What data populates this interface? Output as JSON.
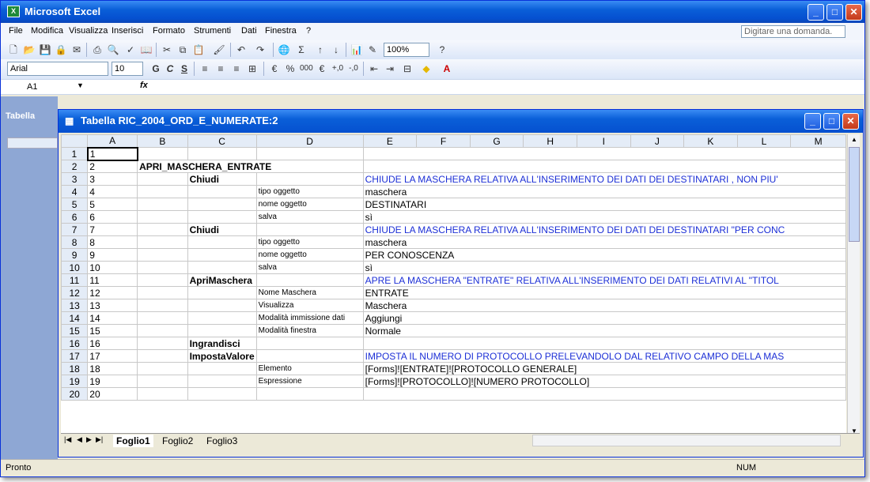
{
  "app": {
    "title": "Microsoft Excel",
    "icon": "excel-icon"
  },
  "menu": {
    "items": [
      "File",
      "Modifica",
      "Visualizza",
      "Inserisci",
      "Formato",
      "Strumenti",
      "Dati",
      "Finestra",
      "?"
    ],
    "help_placeholder": "Digitare una domanda."
  },
  "toolbar": {
    "zoom": "100%"
  },
  "format": {
    "font": "Arial",
    "size": "10"
  },
  "formula_bar": {
    "cell": "A1",
    "fx": "fx",
    "content": ""
  },
  "side_window": {
    "label": "Tabella"
  },
  "window": {
    "title": "Tabella RIC_2004_ORD_E_NUMERATE:2"
  },
  "columns": [
    "A",
    "B",
    "C",
    "D",
    "E",
    "F",
    "G",
    "H",
    "I",
    "J",
    "K",
    "L",
    "M"
  ],
  "row_numbers": [
    "1",
    "2",
    "3",
    "4",
    "5",
    "6",
    "7",
    "8",
    "9",
    "10",
    "11",
    "12",
    "13",
    "14",
    "15",
    "16",
    "17",
    "18",
    "19",
    "20"
  ],
  "rows": [
    {
      "a": "1",
      "b": "",
      "c": "",
      "d": "",
      "e": ""
    },
    {
      "a": "2",
      "b": "APRI_MASCHERA_ENTRATE",
      "c": "",
      "d": "",
      "e": ""
    },
    {
      "a": "3",
      "b": "",
      "c": "Chiudi",
      "d": "",
      "e": "CHIUDE LA MASCHERA RELATIVA ALL'INSERIMENTO DEI DATI DEI DESTINATARI , NON PIU'"
    },
    {
      "a": "4",
      "b": "",
      "c": "",
      "d": "tipo oggetto",
      "e": "maschera"
    },
    {
      "a": "5",
      "b": "",
      "c": "",
      "d": "nome oggetto",
      "e": "DESTINATARI"
    },
    {
      "a": "6",
      "b": "",
      "c": "",
      "d": "salva",
      "e": "sì"
    },
    {
      "a": "7",
      "b": "",
      "c": "Chiudi",
      "d": "",
      "e": "CHIUDE LA MASCHERA RELATIVA ALL'INSERIMENTO DEI DATI DEI DESTINATARI \"PER CONC"
    },
    {
      "a": "8",
      "b": "",
      "c": "",
      "d": "tipo oggetto",
      "e": "maschera"
    },
    {
      "a": "9",
      "b": "",
      "c": "",
      "d": "nome oggetto",
      "e": "PER CONOSCENZA"
    },
    {
      "a": "10",
      "b": "",
      "c": "",
      "d": "salva",
      "e": "sì"
    },
    {
      "a": "11",
      "b": "",
      "c": "ApriMaschera",
      "d": "",
      "e": "APRE LA MASCHERA \"ENTRATE\" RELATIVA ALL'INSERIMENTO DEI DATI RELATIVI AL \"TITOL"
    },
    {
      "a": "12",
      "b": "",
      "c": "",
      "d": "Nome Maschera",
      "e": "ENTRATE"
    },
    {
      "a": "13",
      "b": "",
      "c": "",
      "d": "Visualizza",
      "e": "Maschera"
    },
    {
      "a": "14",
      "b": "",
      "c": "",
      "d": "Modalità immissione dati",
      "e": "Aggiungi"
    },
    {
      "a": "15",
      "b": "",
      "c": "",
      "d": "Modalità finestra",
      "e": "Normale"
    },
    {
      "a": "16",
      "b": "",
      "c": "Ingrandisci",
      "d": "",
      "e": ""
    },
    {
      "a": "17",
      "b": "",
      "c": "ImpostaValore",
      "d": "",
      "e": "IMPOSTA IL NUMERO DI PROTOCOLLO PRELEVANDOLO DAL RELATIVO CAMPO DELLA MAS"
    },
    {
      "a": "18",
      "b": "",
      "c": "",
      "d": "Elemento",
      "e": "[Forms]![ENTRATE]![PROTOCOLLO GENERALE]"
    },
    {
      "a": "19",
      "b": "",
      "c": "",
      "d": "Espressione",
      "e": "[Forms]![PROTOCOLLO]![NUMERO PROTOCOLLO]"
    },
    {
      "a": "20",
      "b": "",
      "c": "",
      "d": "",
      "e": ""
    }
  ],
  "sheets": [
    "Foglio1",
    "Foglio2",
    "Foglio3"
  ],
  "status": {
    "left": "Pronto",
    "num": "NUM"
  },
  "colors": {
    "title_blue": "#0a5fd8",
    "comment_blue": "#1c2fd6"
  }
}
